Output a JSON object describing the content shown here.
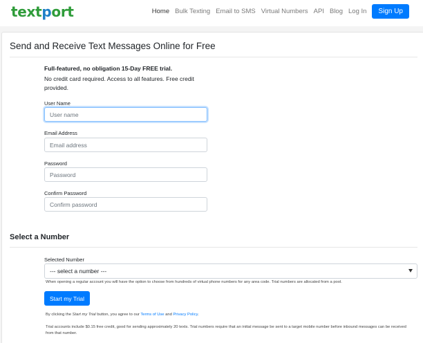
{
  "nav": {
    "logo_main": "text",
    "logo_accent": "p",
    "logo_rest": "ort",
    "links": [
      "Home",
      "Bulk Texting",
      "Email to SMS",
      "Virtual Numbers",
      "API",
      "Blog",
      "Log In"
    ],
    "active_link": "Home",
    "signup_label": "Sign Up"
  },
  "page": {
    "title": "Send and Receive Text Messages Online for Free",
    "intro_strong": "Full-featured, no obligation 15-Day FREE trial.",
    "intro_text": "No credit card required. Access to all features. Free credit provided."
  },
  "form": {
    "username": {
      "label": "User Name",
      "placeholder": "User name",
      "value": ""
    },
    "email": {
      "label": "Email Address",
      "placeholder": "Email address",
      "value": ""
    },
    "password": {
      "label": "Password",
      "placeholder": "Password",
      "value": ""
    },
    "confirm": {
      "label": "Confirm Password",
      "placeholder": "Confirm password",
      "value": ""
    }
  },
  "number": {
    "section_title": "Select a Number",
    "label": "Selected Number",
    "selected": "--- select a number ---",
    "help": "When opening a regular account you will have the option to choose from hundreds of virtual phone numbers for any area code. Trial numbers are allocated from a pool."
  },
  "trial_button": "Start my Trial",
  "terms": {
    "prefix": "By clicking the ",
    "button_ref": "Start my Trial",
    "middle": " button, you agree to our ",
    "terms_link": "Terms of Use",
    "and": " and ",
    "privacy_link": "Privacy Policy",
    "suffix": "."
  },
  "note": "Trial accounts include $0.15 free credit, good for sending approximately 20 texts. Trial numbers require that an initial message be sent to a target mobile number before inbound messages can be received from that number.",
  "colors": {
    "primary": "#007bff",
    "logo_green": "#2f9c3a",
    "logo_blue": "#1e7fc7"
  }
}
